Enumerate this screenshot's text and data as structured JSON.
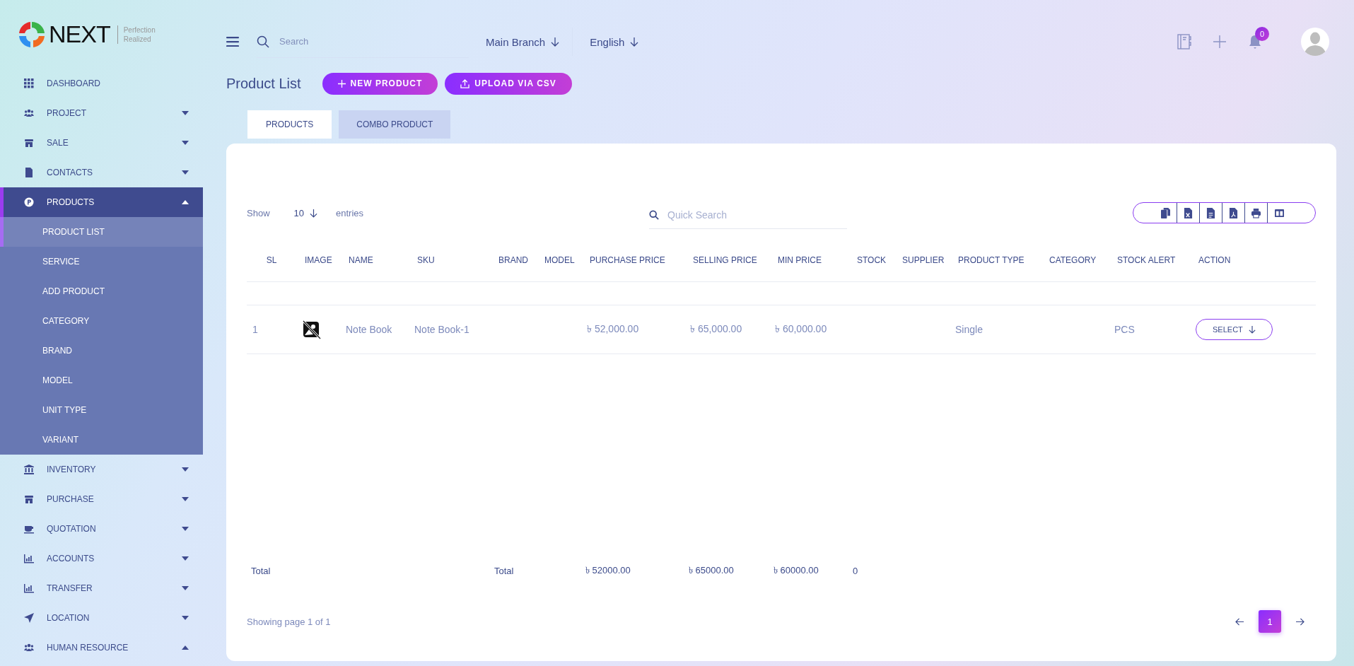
{
  "brand": {
    "name": "NEXT",
    "tagline": "Perfection Realized"
  },
  "sidebar": {
    "items": [
      {
        "label": "DASHBOARD",
        "selected": false
      },
      {
        "label": "PROJECT",
        "selected": false,
        "expanded": false
      },
      {
        "label": "SALE",
        "selected": false,
        "expanded": false
      },
      {
        "label": "CONTACTS",
        "selected": false,
        "expanded": false
      },
      {
        "label": "PRODUCTS",
        "selected": true,
        "expanded": true,
        "children": [
          {
            "label": "PRODUCT LIST",
            "selected": true
          },
          {
            "label": "SERVICE",
            "selected": false
          },
          {
            "label": "ADD PRODUCT",
            "selected": false
          },
          {
            "label": "CATEGORY",
            "selected": false
          },
          {
            "label": "BRAND",
            "selected": false
          },
          {
            "label": "MODEL",
            "selected": false
          },
          {
            "label": "UNIT TYPE",
            "selected": false
          },
          {
            "label": "VARIANT",
            "selected": false
          }
        ]
      },
      {
        "label": "INVENTORY",
        "selected": false,
        "expanded": false
      },
      {
        "label": "PURCHASE",
        "selected": false,
        "expanded": false
      },
      {
        "label": "QUOTATION",
        "selected": false,
        "expanded": false
      },
      {
        "label": "ACCOUNTS",
        "selected": false,
        "expanded": false
      },
      {
        "label": "TRANSFER",
        "selected": false,
        "expanded": false
      },
      {
        "label": "LOCATION",
        "selected": false,
        "expanded": false
      },
      {
        "label": "HUMAN RESOURCE",
        "selected": false,
        "expanded": true
      }
    ]
  },
  "header": {
    "search": {
      "placeholder": "Search"
    },
    "branch": "Main Branch",
    "language": "English",
    "notification_count": "0"
  },
  "page": {
    "title": "Product List",
    "buttons": [
      "NEW PRODUCT",
      "UPLOAD VIA CSV"
    ]
  },
  "tabs": [
    {
      "label": "PRODUCTS",
      "selected": true
    },
    {
      "label": "COMBO PRODUCT",
      "selected": false
    }
  ],
  "table_controls": {
    "show_label": "Show",
    "page_size": "10",
    "entries_label": "entries",
    "search": {
      "placeholder": "Quick Search"
    }
  },
  "table": {
    "columns": [
      "SL",
      "IMAGE",
      "NAME",
      "SKU",
      "BRAND",
      "MODEL",
      "PURCHASE PRICE",
      "SELLING PRICE",
      "MIN PRICE",
      "STOCK",
      "SUPPLIER",
      "PRODUCT TYPE",
      "CATEGORY",
      "STOCK ALERT",
      "ACTION"
    ],
    "rows": [
      {
        "sl": "1",
        "name": "Note Book",
        "sku": "Note Book-1",
        "purchase_price": "৳ 52,000.00",
        "selling_price": "৳ 65,000.00",
        "min_price": "৳ 60,000.00",
        "product_type": "Single",
        "stock_alert": "PCS",
        "action": "SELECT"
      }
    ],
    "totals": {
      "label": "Total",
      "brand": "Total",
      "purchase_price": "৳ 52000.00",
      "selling_price": "৳ 65000.00",
      "min_price": "৳ 60000.00",
      "stock": "0"
    }
  },
  "footer": {
    "summary": "Showing page 1 of 1",
    "pages": [
      {
        "label": "1",
        "selected": true
      }
    ]
  }
}
